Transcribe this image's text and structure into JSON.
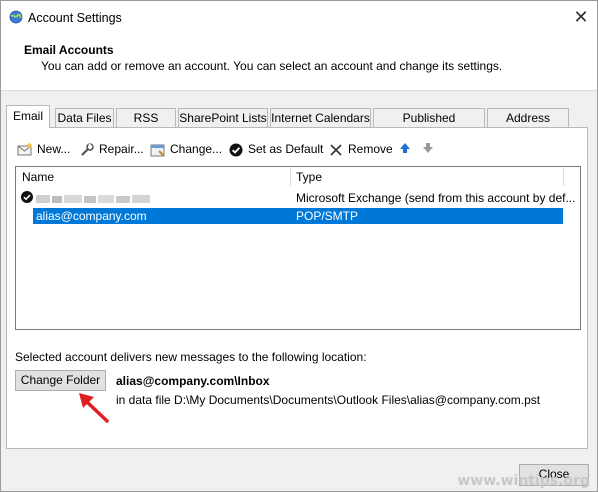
{
  "window": {
    "title": "Account Settings",
    "close_glyph": "✕"
  },
  "header": {
    "title": "Email Accounts",
    "subtitle": "You can add or remove an account. You can select an account and change its settings."
  },
  "tabs": [
    {
      "label": "Email",
      "active": true
    },
    {
      "label": "Data Files"
    },
    {
      "label": "RSS Feeds"
    },
    {
      "label": "SharePoint Lists"
    },
    {
      "label": "Internet Calendars"
    },
    {
      "label": "Published Calendars"
    },
    {
      "label": "Address Books"
    }
  ],
  "toolbar": {
    "new_label": "New...",
    "repair_label": "Repair...",
    "change_label": "Change...",
    "set_default_label": "Set as Default",
    "remove_label": "Remove",
    "move_up_icon": "arrow-up-icon",
    "move_down_icon": "arrow-down-icon"
  },
  "accounts_list": {
    "columns": [
      "Name",
      "Type"
    ],
    "rows": [
      {
        "name": "",
        "type": "Microsoft Exchange (send from this account by def...",
        "default": true
      },
      {
        "name": "alias@company.com",
        "type": "POP/SMTP",
        "selected": true
      }
    ]
  },
  "delivery": {
    "caption": "Selected account delivers new messages to the following location:",
    "change_folder_label": "Change Folder",
    "folder_path": "alias@company.com\\Inbox",
    "data_file_text": "in data file D:\\My Documents\\Documents\\Outlook Files\\alias@company.com.pst"
  },
  "footer": {
    "close_label": "Close"
  },
  "watermark": "www.wintips.org",
  "colors": {
    "selection": "#0078d7",
    "annotation_arrow": "#e02020",
    "up_arrow": "#1e6fd8",
    "down_arrow": "#9a9a9a"
  }
}
